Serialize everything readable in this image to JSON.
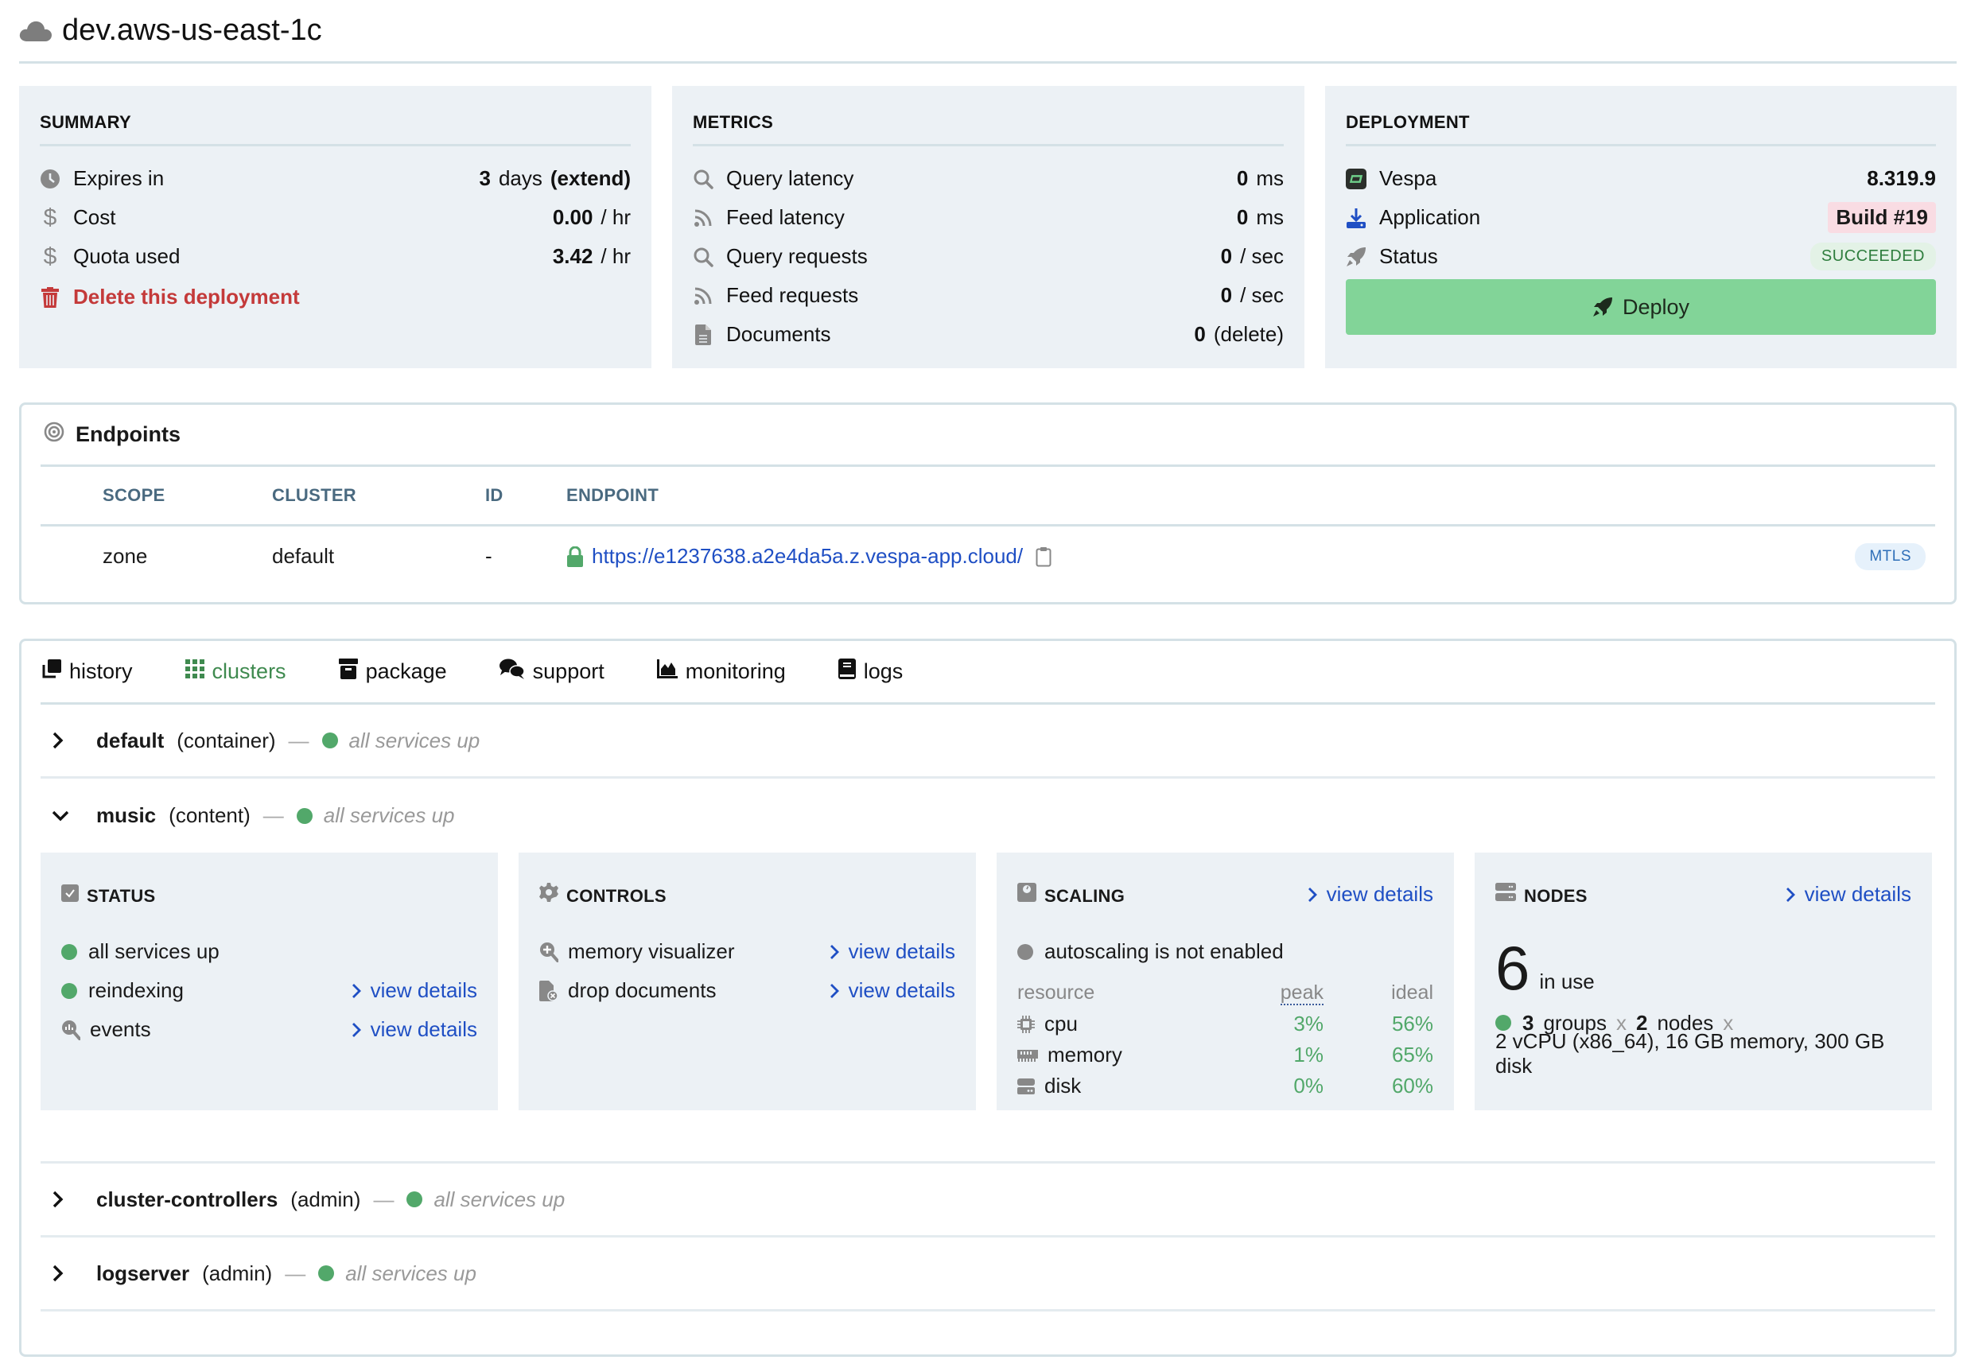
{
  "header": {
    "title": "dev.aws-us-east-1c",
    "icon": "cloud-icon"
  },
  "summary": {
    "heading": "SUMMARY",
    "rows": [
      {
        "icon": "clock-icon",
        "label": "Expires in",
        "value": "3",
        "unit": "days",
        "link": "(extend)"
      },
      {
        "icon": "dollar-icon",
        "label": "Cost",
        "value": "0.00",
        "unit": "/ hr"
      },
      {
        "icon": "dollar-icon",
        "label": "Quota used",
        "value": "3.42",
        "unit": "/ hr"
      }
    ],
    "delete_label": "Delete this deployment"
  },
  "metrics": {
    "heading": "METRICS",
    "rows": [
      {
        "icon": "search-icon",
        "label": "Query latency",
        "value": "0",
        "unit": "ms"
      },
      {
        "icon": "rss-icon",
        "label": "Feed latency",
        "value": "0",
        "unit": "ms"
      },
      {
        "icon": "search-icon",
        "label": "Query requests",
        "value": "0",
        "unit": "/ sec"
      },
      {
        "icon": "rss-icon",
        "label": "Feed requests",
        "value": "0",
        "unit": "/ sec"
      },
      {
        "icon": "document-icon",
        "label": "Documents",
        "value": "0",
        "link": "(delete)"
      }
    ]
  },
  "deployment": {
    "heading": "DEPLOYMENT",
    "vespa_label": "Vespa",
    "vespa_version": "8.319.9",
    "application_label": "Application",
    "build": "Build #19",
    "status_label": "Status",
    "status_value": "SUCCEEDED",
    "deploy_button": "Deploy"
  },
  "endpoints": {
    "heading": "Endpoints",
    "columns": [
      "SCOPE",
      "CLUSTER",
      "ID",
      "ENDPOINT"
    ],
    "rows": [
      {
        "scope": "zone",
        "cluster": "default",
        "id": "-",
        "endpoint": "https://e1237638.a2e4da5a.z.vespa-app.cloud/",
        "auth": "MTLS"
      }
    ]
  },
  "tabs": [
    {
      "label": "history",
      "icon": "history-icon",
      "active": false
    },
    {
      "label": "clusters",
      "icon": "grid-icon",
      "active": true
    },
    {
      "label": "package",
      "icon": "archive-icon",
      "active": false
    },
    {
      "label": "support",
      "icon": "comments-icon",
      "active": false
    },
    {
      "label": "monitoring",
      "icon": "area-chart-icon",
      "active": false
    },
    {
      "label": "logs",
      "icon": "book-icon",
      "active": false
    }
  ],
  "clusters": [
    {
      "name": "default",
      "type": "(container)",
      "status": "all services up",
      "expanded": false
    },
    {
      "name": "music",
      "type": "(content)",
      "status": "all services up",
      "expanded": true
    },
    {
      "name": "cluster-controllers",
      "type": "(admin)",
      "status": "all services up",
      "expanded": false
    },
    {
      "name": "logserver",
      "type": "(admin)",
      "status": "all services up",
      "expanded": false
    }
  ],
  "music_details": {
    "status": {
      "heading": "STATUS",
      "rows": [
        {
          "label": "all services up"
        },
        {
          "label": "reindexing",
          "link": "view details"
        },
        {
          "label": "events",
          "link": "view details"
        }
      ]
    },
    "controls": {
      "heading": "CONTROLS",
      "rows": [
        {
          "label": "memory visualizer",
          "link": "view details"
        },
        {
          "label": "drop documents",
          "link": "view details"
        }
      ]
    },
    "scaling": {
      "heading": "SCALING",
      "link": "view details",
      "autoscaling": "autoscaling is not enabled",
      "columns": [
        "resource",
        "peak",
        "ideal"
      ],
      "rows": [
        {
          "resource": "cpu",
          "peak": "3%",
          "ideal": "56%"
        },
        {
          "resource": "memory",
          "peak": "1%",
          "ideal": "65%"
        },
        {
          "resource": "disk",
          "peak": "0%",
          "ideal": "60%"
        }
      ]
    },
    "nodes": {
      "heading": "NODES",
      "link": "view details",
      "count": "6",
      "count_label": "in use",
      "groups": "3",
      "groups_label": "groups",
      "nodes": "2",
      "nodes_label": "nodes",
      "times": "x",
      "spec": "2 vCPU (x86_64), 16 GB memory, 300 GB disk"
    }
  }
}
